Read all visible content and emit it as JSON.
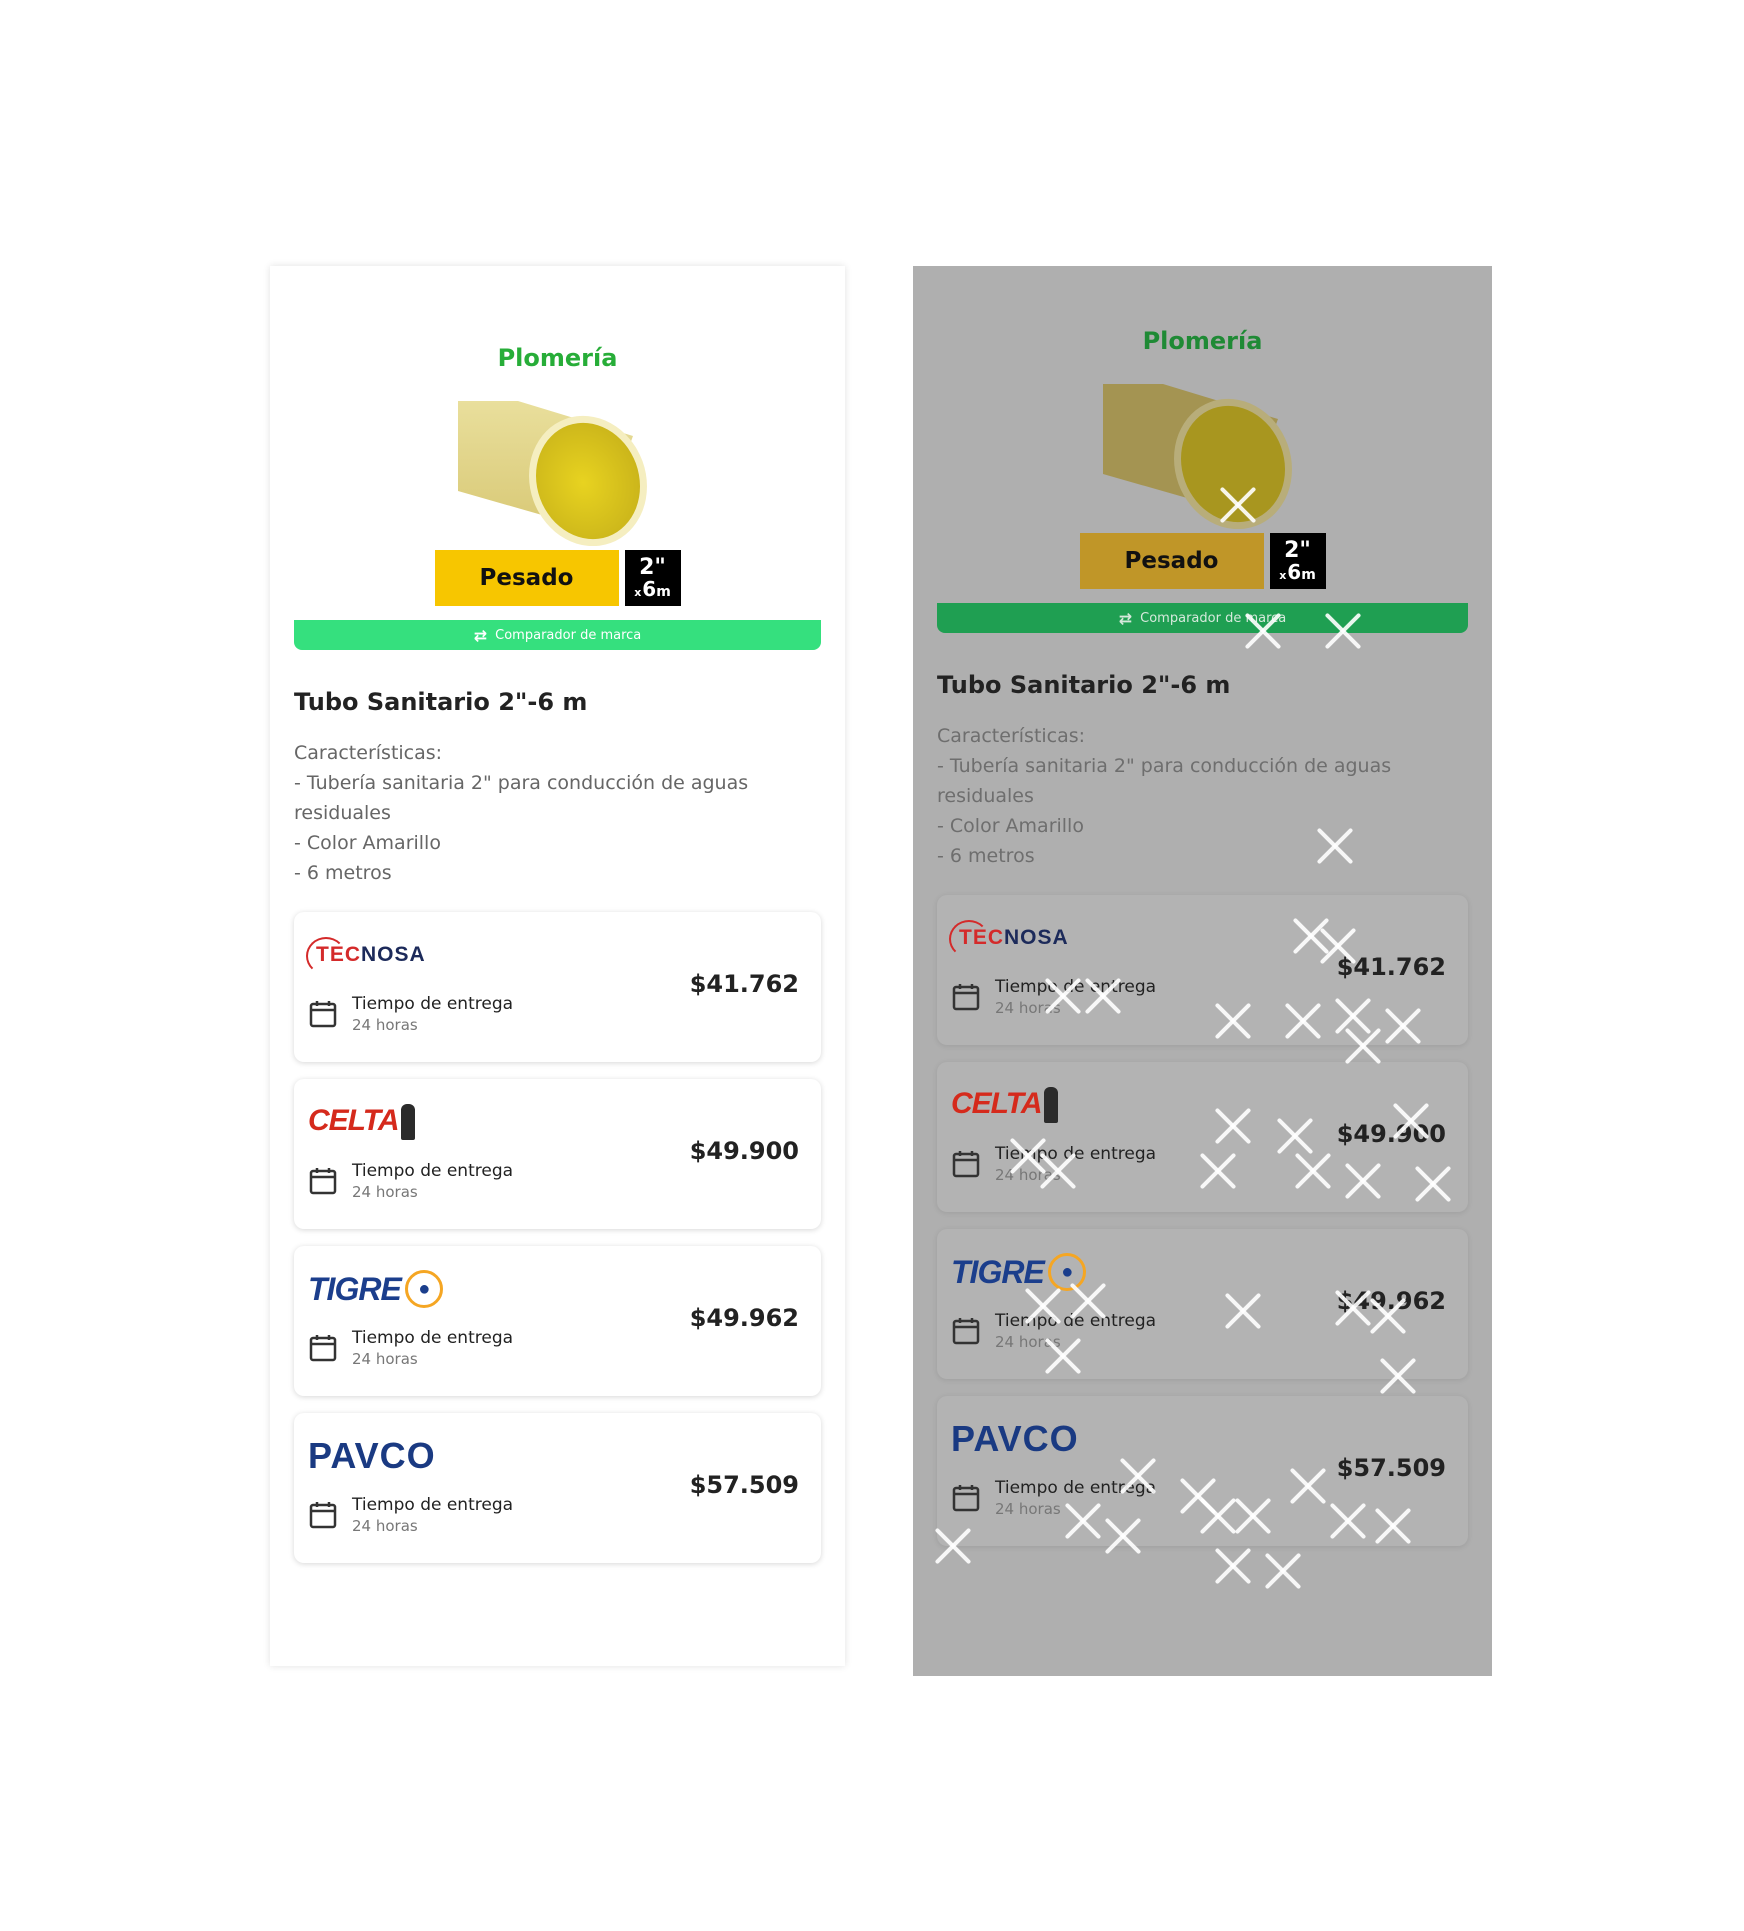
{
  "category": "Plomería",
  "product": {
    "type_badge": "Pesado",
    "size_top": "2\"",
    "size_x": "x",
    "size_length": "6",
    "size_unit": "m",
    "compare_label": "Comparador de marca",
    "title": "Tubo Sanitario 2\"-6 m",
    "description": [
      "Características:",
      "- Tubería sanitaria 2\" para conducción de aguas residuales",
      "- Color Amarillo",
      "- 6 metros"
    ]
  },
  "suppliers": [
    {
      "brand": "TECNOSA",
      "brand_tec": "TEC",
      "brand_rest": "NOSA",
      "delivery_label": "Tiempo de entrega",
      "delivery_time": "24 horas",
      "price": "$41.762"
    },
    {
      "brand": "CELTA",
      "delivery_label": "Tiempo de entrega",
      "delivery_time": "24 horas",
      "price": "$49.900"
    },
    {
      "brand": "TIGRE",
      "delivery_label": "Tiempo de entrega",
      "delivery_time": "24 horas",
      "price": "$49.962"
    },
    {
      "brand": "PAVCO",
      "delivery_label": "Tiempo de entrega",
      "delivery_time": "24 horas",
      "price": "$57.509"
    }
  ],
  "colors": {
    "category_green": "#27ad38",
    "compare_bar": "#35e07e",
    "badge_yellow": "#f7c600",
    "pipe_yellow": "#e6d98a",
    "overlay_gray": "#afafaf"
  },
  "icons": {
    "compare": "compare-arrows-icon",
    "calendar": "calendar-icon"
  }
}
